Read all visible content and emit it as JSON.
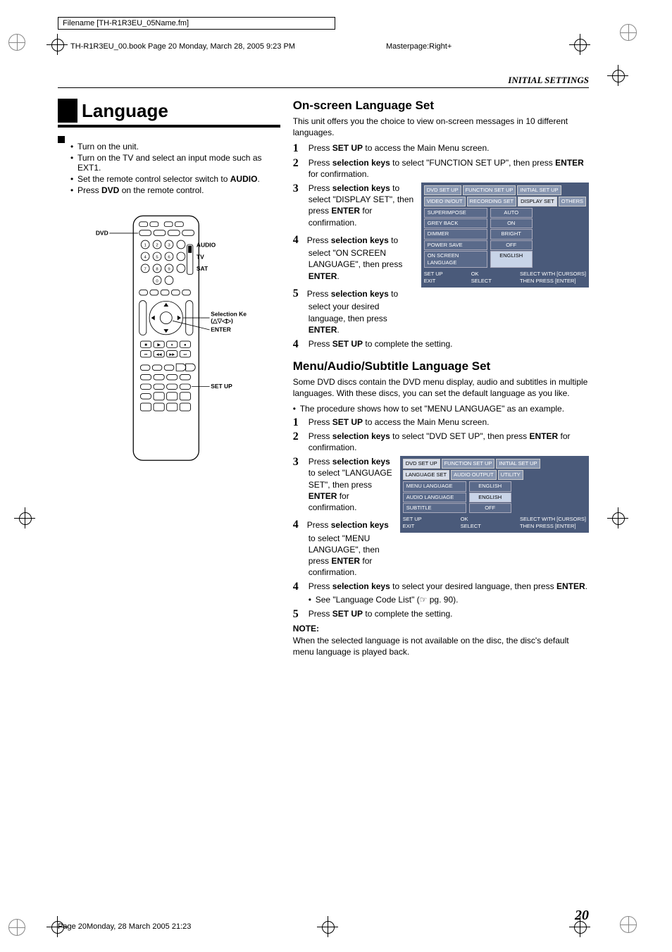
{
  "meta": {
    "filename_label": "Filename [TH-R1R3EU_05Name.fm]",
    "book_line": "TH-R1R3EU_00.book  Page 20  Monday, March 28, 2005  9:23 PM",
    "masterpage": "Masterpage:Right+",
    "section_header": "INITIAL SETTINGS",
    "page_number": "20",
    "footer": "Page 20Monday, 28 March 2005  21:23"
  },
  "left": {
    "title": "Language",
    "intro": [
      "Turn on the unit.",
      "Turn on the TV and select an input mode such as EXT1.",
      "Set the remote control selector switch to <b>AUDIO</b>.",
      "Press <b>DVD</b> on the remote control."
    ],
    "fig": {
      "dvd_label": "DVD",
      "switch_labels": {
        "audio": "AUDIO",
        "tv": "TV",
        "sat": "SAT"
      },
      "selection_keys_label": "Selection Keys",
      "selection_keys_symbols": "(△▽◁▷)",
      "enter_label": "ENTER",
      "setup_label": "SET UP"
    }
  },
  "right": {
    "sec1": {
      "heading": "On-screen Language Set",
      "intro": "This unit offers you the choice to view on-screen messages in 10 different languages.",
      "steps": [
        "Press <b>SET UP</b> to access the Main Menu screen.",
        "Press <b>selection keys</b> to select \"FUNCTION SET UP\", then press <b>ENTER</b> for confirmation.",
        "Press <b>selection keys</b> to select \"DISPLAY SET\", then press <b>ENTER</b> for confirmation.",
        "Press <b>selection keys</b> to select \"ON SCREEN LANGUAGE\", then press <b>ENTER</b>.",
        "Press <b>selection keys</b> to select your desired language, then press <b>ENTER</b>.",
        "Press <b>SET UP</b> to complete the setting."
      ],
      "osd": {
        "tabs1": [
          "DVD SET UP",
          "FUNCTION SET UP",
          "INITIAL SET UP"
        ],
        "tabs2": [
          "VIDEO IN/OUT",
          "RECORDING SET",
          "DISPLAY SET",
          "OTHERS"
        ],
        "tabs2_selected": 2,
        "rows": [
          {
            "k": "SUPERIMPOSE",
            "v": "AUTO"
          },
          {
            "k": "GREY BACK",
            "v": "ON"
          },
          {
            "k": "DIMMER",
            "v": "BRIGHT"
          },
          {
            "k": "POWER SAVE",
            "v": "OFF"
          },
          {
            "k": "ON SCREEN LANGUAGE",
            "v": "ENGLISH",
            "sel": true
          }
        ],
        "foot_left": "SET UP\nEXIT",
        "foot_mid": "OK\nSELECT",
        "foot_right": "SELECT WITH [CURSORS]\nTHEN PRESS [ENTER]"
      }
    },
    "sec2": {
      "heading": "Menu/Audio/Subtitle Language Set",
      "intro": "Some DVD discs contain the DVD menu display, audio and subtitles in multiple languages. With these discs, you can set the default language as you like.",
      "bullet": "The procedure shows how to set \"MENU LANGUAGE\" as an example.",
      "steps": [
        "Press <b>SET UP</b> to access the Main Menu screen.",
        "Press <b>selection keys</b> to select \"DVD SET UP\", then press <b>ENTER</b> for confirmation.",
        "Press <b>selection keys</b> to select \"LANGUAGE SET\", then press <b>ENTER</b> for confirmation.",
        "Press <b>selection keys</b> to select \"MENU LANGUAGE\", then press <b>ENTER</b> for confirmation.",
        "Press <b>selection keys</b> to select your desired language, then press <b>ENTER</b>."
      ],
      "step5_sub": "See \"Language Code List\" (☞ pg. 90).",
      "step6": "Press <b>SET UP</b> to complete the setting.",
      "osd": {
        "tabs1": [
          "DVD SET UP",
          "FUNCTION SET UP",
          "INITIAL SET UP"
        ],
        "tabs1_selected": 0,
        "tabs2": [
          "LANGUAGE SET",
          "AUDIO OUTPUT",
          "UTILITY"
        ],
        "tabs2_selected": 0,
        "rows": [
          {
            "k": "MENU LANGUAGE",
            "v": "ENGLISH"
          },
          {
            "k": "AUDIO LANGUAGE",
            "v": "ENGLISH",
            "sel": true
          },
          {
            "k": "SUBTITLE",
            "v": "OFF"
          }
        ],
        "foot_left": "SET UP\nEXIT",
        "foot_mid": "OK\nSELECT",
        "foot_right": "SELECT WITH [CURSORS]\nTHEN PRESS [ENTER]"
      },
      "note_head": "NOTE:",
      "note_body": "When the selected language is not available on the disc, the disc's default menu language is played back."
    }
  }
}
